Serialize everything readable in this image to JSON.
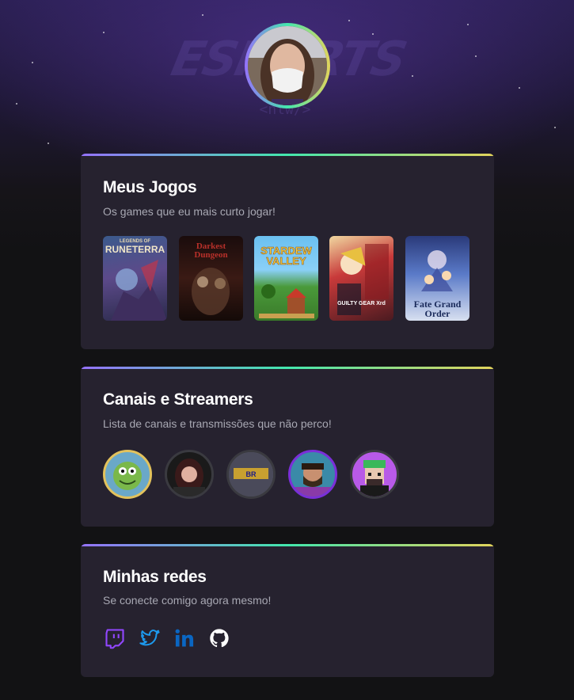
{
  "background": {
    "logo_text": "ESPORTS",
    "logo_sub": "<nlw/>"
  },
  "profile": {
    "avatar_icon": "profile-photo"
  },
  "games_section": {
    "title": "Meus Jogos",
    "subtitle": "Os games que eu mais curto jogar!",
    "games": [
      {
        "name": "Legends of Runeterra",
        "cover_title": "RUNETERRA",
        "cover_sup": "LEGENDS OF"
      },
      {
        "name": "Darkest Dungeon",
        "cover_title": "Darkest Dungeon"
      },
      {
        "name": "Stardew Valley",
        "cover_title": "STARDEW VALLEY"
      },
      {
        "name": "Guilty Gear Xrd",
        "cover_title": "GUILTY GEAR Xrd"
      },
      {
        "name": "Fate/Grand Order",
        "cover_title": "Fate Grand Order"
      }
    ]
  },
  "streamers_section": {
    "title": "Canais e Streamers",
    "subtitle": "Lista de canais e transmissões que não perco!",
    "streamers": [
      {
        "name": "streamer-1",
        "ring": "#e2c25c"
      },
      {
        "name": "streamer-2",
        "ring": "#3a3a40"
      },
      {
        "name": "streamer-3",
        "ring": "#3a3a40"
      },
      {
        "name": "streamer-4",
        "ring": "#7a2fd8"
      },
      {
        "name": "streamer-5",
        "ring": "#3a3a40"
      }
    ]
  },
  "social_section": {
    "title": "Minhas redes",
    "subtitle": "Se conecte comigo agora mesmo!",
    "links": [
      {
        "icon": "twitch-icon",
        "color": "#9147ff"
      },
      {
        "icon": "twitter-icon",
        "color": "#1d9bf0"
      },
      {
        "icon": "linkedin-icon",
        "color": "#0a66c2"
      },
      {
        "icon": "github-icon",
        "color": "#ffffff"
      }
    ]
  },
  "colors": {
    "gradient": [
      "#9572fc",
      "#43e7ad",
      "#e2d45c"
    ],
    "card_bg": "#26222f",
    "page_bg": "#121214"
  }
}
